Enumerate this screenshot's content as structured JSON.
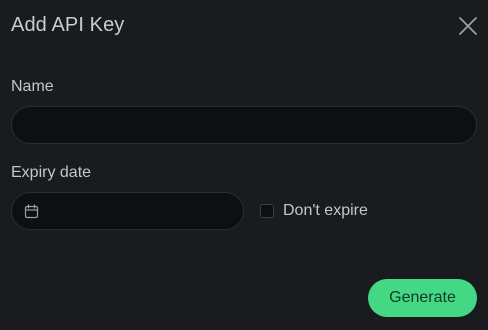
{
  "dialog": {
    "title": "Add API Key",
    "close_icon": "close-icon"
  },
  "form": {
    "name": {
      "label": "Name",
      "value": "",
      "placeholder": ""
    },
    "expiry": {
      "label": "Expiry date",
      "value": "",
      "placeholder": "",
      "icon": "calendar-icon"
    },
    "dont_expire": {
      "label": "Don't expire",
      "checked": false
    }
  },
  "actions": {
    "generate_label": "Generate"
  },
  "colors": {
    "background": "#1a1b1f",
    "input_background": "#0e0f12",
    "accent": "#45d884",
    "text": "#c9ccd2"
  }
}
